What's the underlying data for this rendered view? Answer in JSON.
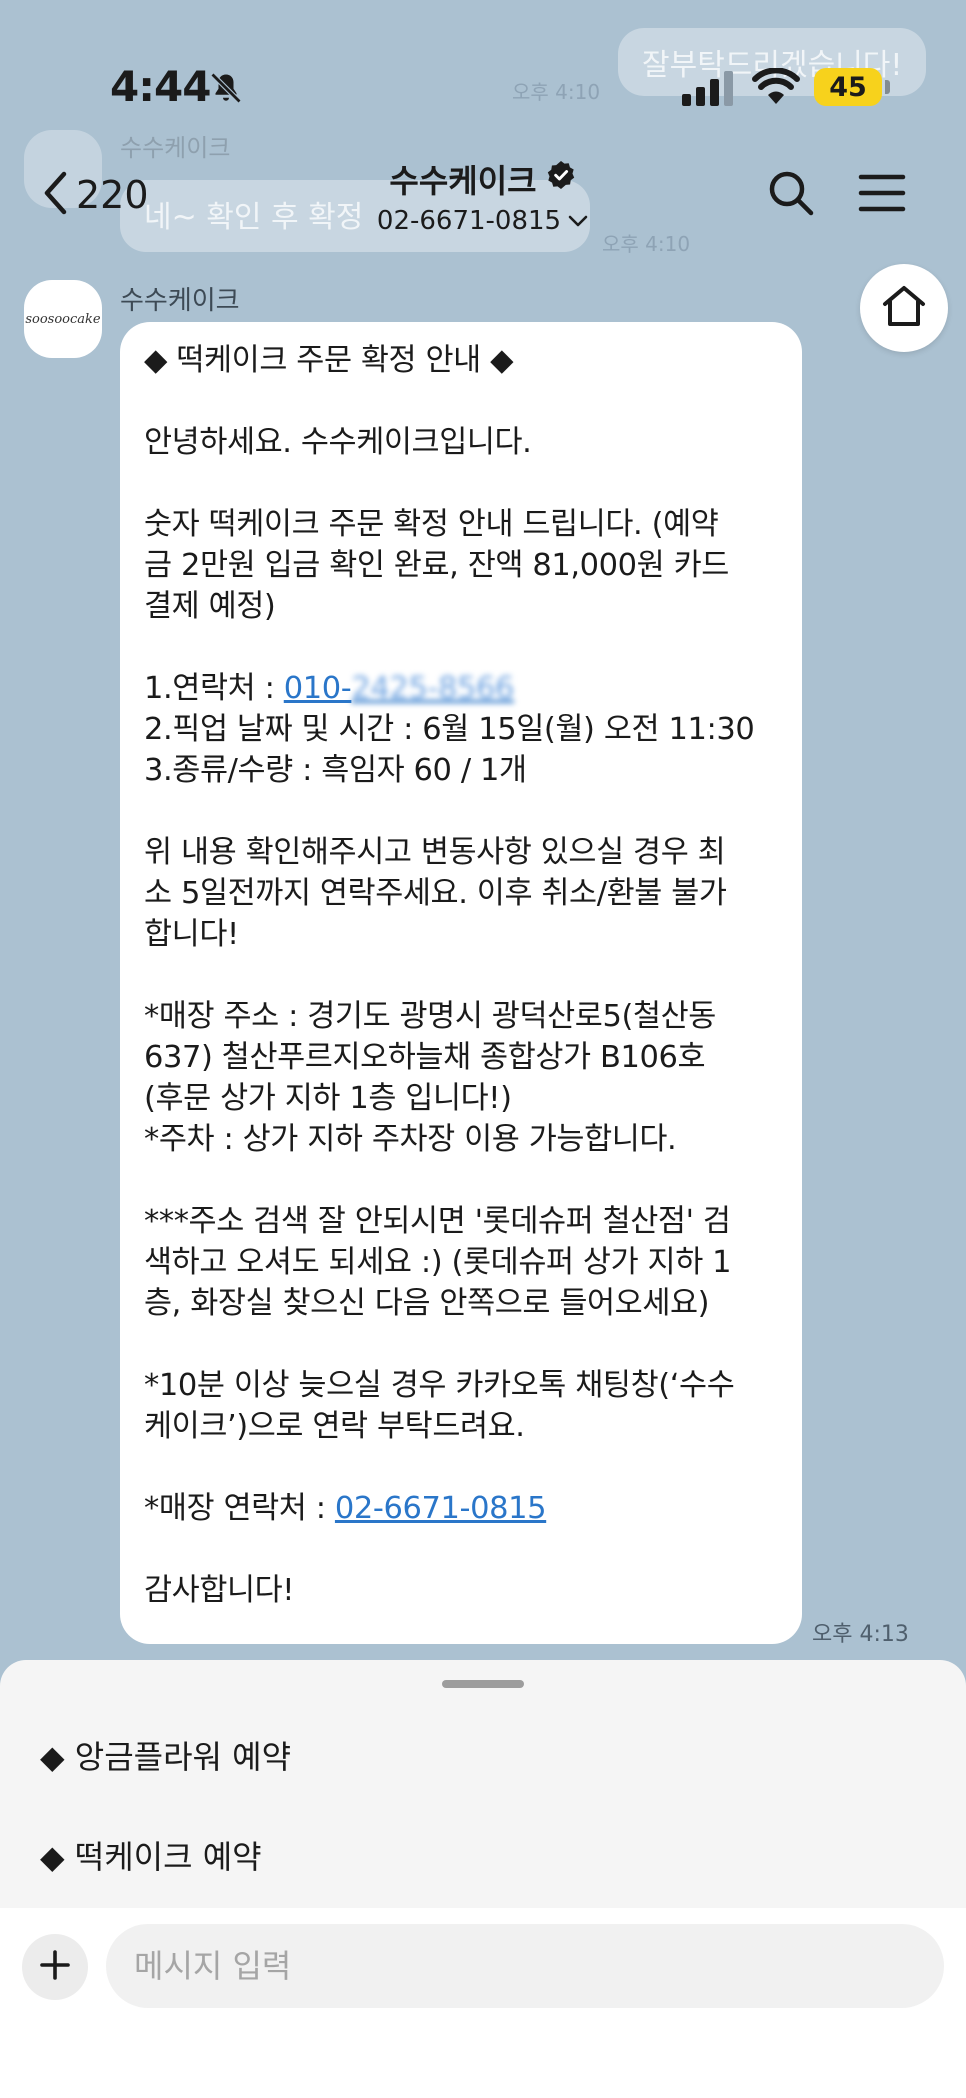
{
  "ghost": {
    "top_message": "잘부탁드리겠습니다!",
    "top_time": "오후 4:10",
    "sender": "수수케이크",
    "mid_message": "네~ 확인 후 확정",
    "mid_time": "오후 4:10"
  },
  "status_bar": {
    "time": "4:44",
    "battery": "45"
  },
  "header": {
    "back_count": "220",
    "title": "수수케이크",
    "phone": "02-6671-0815"
  },
  "message": {
    "sender": "수수케이크",
    "avatar_logo": "soosoocake",
    "time": "오후 4:13",
    "lines": {
      "l1": "◆ 떡케이크 주문 확정 안내 ◆",
      "l2": "안녕하세요. 수수케이크입니다.",
      "l3": "숫자 떡케이크 주문 확정 안내 드립니다. (예약",
      "l4": "금 2만원 입금 확인 완료, 잔액 81,000원 카드",
      "l5": "결제 예정)",
      "l6_label": "1.연락처 : ",
      "l6_prefix": "010-",
      "l6_hidden": "2425-8566",
      "l7": "2.픽업 날짜 및 시간 : 6월 15일(월) 오전 11:30",
      "l8": "3.종류/수량 : 흑임자 60 / 1개",
      "l9": "위 내용 확인해주시고 변동사항 있으실 경우 최",
      "l10": "소 5일전까지 연락주세요. 이후 취소/환불 불가",
      "l11": "합니다!",
      "l12": "*매장 주소 : 경기도 광명시 광덕산로5(철산동",
      "l13": "637) 철산푸르지오하늘채 종합상가 B106호",
      "l14": "(후문 상가 지하 1층 입니다!)",
      "l15": "*주차 : 상가 지하 주차장 이용 가능합니다.",
      "l16": "***주소 검색 잘 안되시면 '롯데슈퍼 철산점' 검",
      "l17": "색하고 오셔도 되세요 :) (롯데슈퍼 상가 지하 1",
      "l18": "층, 화장실 찾으신 다음 안쪽으로 들어오세요)",
      "l19": "*10분 이상 늦으실 경우 카카오톡 채팅창(‘수수",
      "l20": "케이크’)으로 연락 부탁드려요.",
      "l21_label": "*매장 연락처 : ",
      "l21_link": "02-6671-0815",
      "l22": "감사합니다!"
    }
  },
  "quick_replies": [
    "◆ 앙금플라워 예약",
    "◆ 떡케이크 예약"
  ],
  "input": {
    "placeholder": "메시지 입력"
  }
}
